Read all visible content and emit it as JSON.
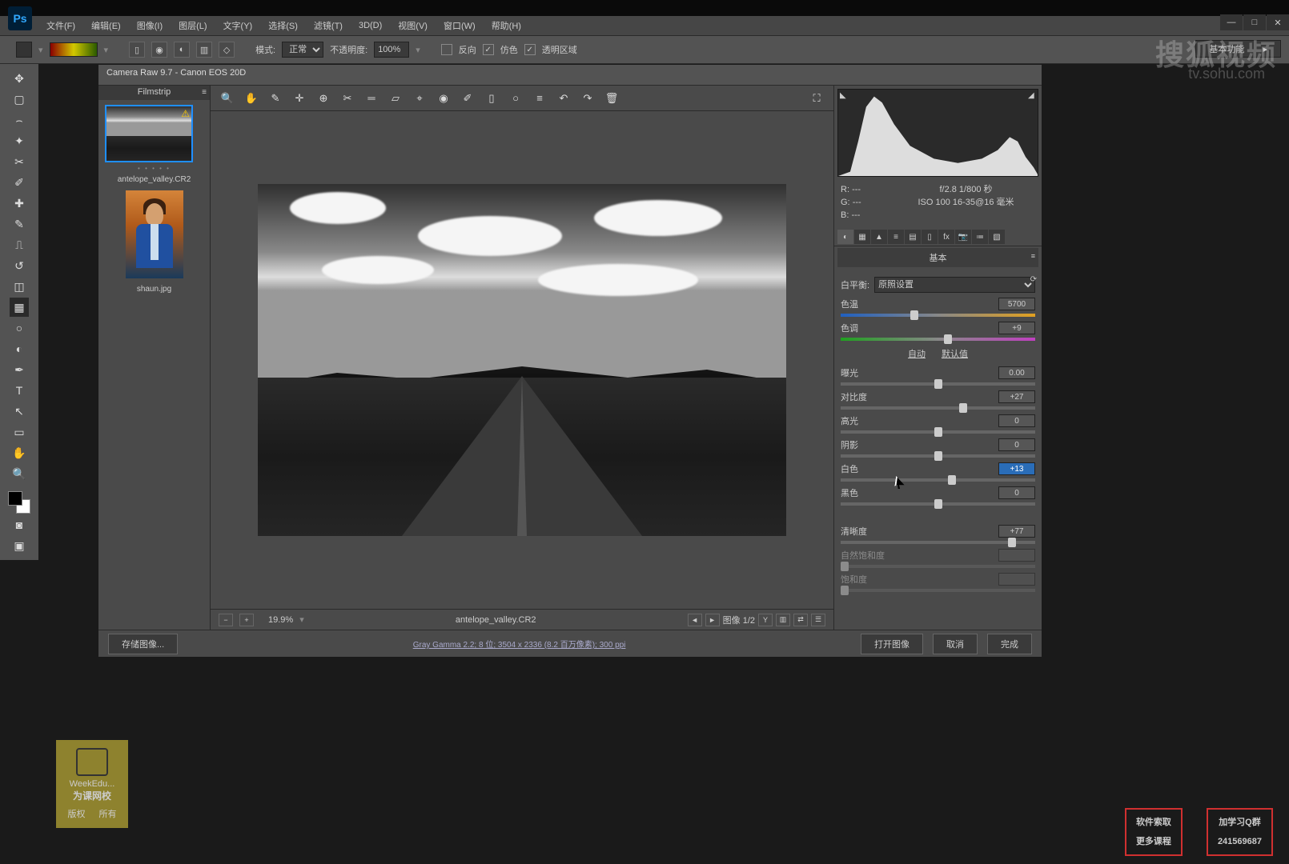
{
  "ps_logo": "Ps",
  "menu": [
    "文件(F)",
    "编辑(E)",
    "图像(I)",
    "图层(L)",
    "文字(Y)",
    "选择(S)",
    "滤镜(T)",
    "3D(D)",
    "视图(V)",
    "窗口(W)",
    "帮助(H)"
  ],
  "optbar": {
    "mode_label": "模式:",
    "mode_value": "正常",
    "opacity_label": "不透明度:",
    "opacity_value": "100%",
    "reverse": "反向",
    "dither": "仿色",
    "transparency": "透明区域"
  },
  "workspace": "基本功能",
  "watermark": "搜狐视频",
  "watermark2": "tv.sohu.com",
  "wincontrols": {
    "min": "—",
    "max": "□",
    "close": "✕"
  },
  "acr": {
    "title": "Camera Raw 9.7  -  Canon EOS 20D",
    "filmstrip_label": "Filmstrip",
    "thumbs": [
      {
        "name": "antelope_valley.CR2",
        "selected": true,
        "rating": "• • • • •"
      },
      {
        "name": "shaun.jpg",
        "selected": false
      }
    ],
    "zoom": "19.9%",
    "preview_filename": "antelope_valley.CR2",
    "image_counter": "图像 1/2",
    "save_images": "存储图像...",
    "workflow_link": "Gray Gamma 2.2; 8 位; 3504 x 2336 (8.2 百万像素); 300 ppi",
    "open": "打开图像",
    "cancel": "取消",
    "done": "完成"
  },
  "exif": {
    "r": "R:",
    "r_v": "---",
    "g": "G:",
    "g_v": "---",
    "b": "B:",
    "b_v": "---",
    "aperture_shutter": "f/2.8  1/800 秒",
    "iso_lens": "ISO 100   16-35@16 毫米"
  },
  "panel": {
    "title": "基本",
    "wb_label": "白平衡:",
    "wb_value": "原照设置",
    "auto": "自动",
    "default": "默认值",
    "sliders": [
      {
        "label": "色温",
        "value": "5700",
        "pos": 38,
        "track": "temp"
      },
      {
        "label": "色调",
        "value": "+9",
        "pos": 55,
        "track": "tint"
      },
      {
        "label": "曝光",
        "value": "0.00",
        "pos": 50
      },
      {
        "label": "对比度",
        "value": "+27",
        "pos": 63
      },
      {
        "label": "高光",
        "value": "0",
        "pos": 50
      },
      {
        "label": "阴影",
        "value": "0",
        "pos": 50
      },
      {
        "label": "白色",
        "value": "+13",
        "pos": 57,
        "hl": true
      },
      {
        "label": "黑色",
        "value": "0",
        "pos": 50
      },
      {
        "label": "清晰度",
        "value": "+77",
        "pos": 88
      },
      {
        "label": "自然饱和度",
        "value": "",
        "pos": 2,
        "dis": true
      },
      {
        "label": "饱和度",
        "value": "",
        "pos": 2,
        "dis": true
      }
    ]
  },
  "overlay": {
    "box1a": "软件索取",
    "box1b": "更多课程",
    "box2a": "加学习Q群",
    "box2b": "241569687"
  },
  "minilogo": {
    "l1": "WeekEdu...",
    "l2": "为课网校",
    "l3": "版权",
    "l4": "所有"
  }
}
